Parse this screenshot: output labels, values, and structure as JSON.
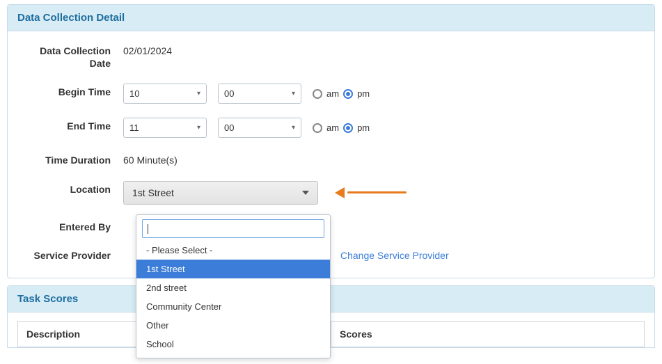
{
  "panel1": {
    "title": "Data Collection Detail"
  },
  "labels": {
    "date": "Data Collection Date",
    "begin": "Begin Time",
    "end": "End Time",
    "duration": "Time Duration",
    "location": "Location",
    "entered": "Entered By",
    "provider": "Service Provider"
  },
  "date_value": "02/01/2024",
  "begin": {
    "hour": "10",
    "minute": "00",
    "am": "am",
    "pm": "pm",
    "selected": "pm"
  },
  "end": {
    "hour": "11",
    "minute": "00",
    "am": "am",
    "pm": "pm",
    "selected": "pm"
  },
  "duration_value": "60 Minute(s)",
  "location_selected": "1st Street",
  "dropdown": {
    "search_value": "",
    "options": [
      {
        "label": "- Please Select -",
        "selected": false
      },
      {
        "label": "1st Street",
        "selected": true
      },
      {
        "label": "2nd street",
        "selected": false
      },
      {
        "label": "Community Center",
        "selected": false
      },
      {
        "label": "Other",
        "selected": false
      },
      {
        "label": "School",
        "selected": false
      }
    ]
  },
  "change_provider": "Change Service Provider",
  "panel2": {
    "title": "Task Scores"
  },
  "task_table": {
    "col1": "Description",
    "col2": "Scores"
  }
}
